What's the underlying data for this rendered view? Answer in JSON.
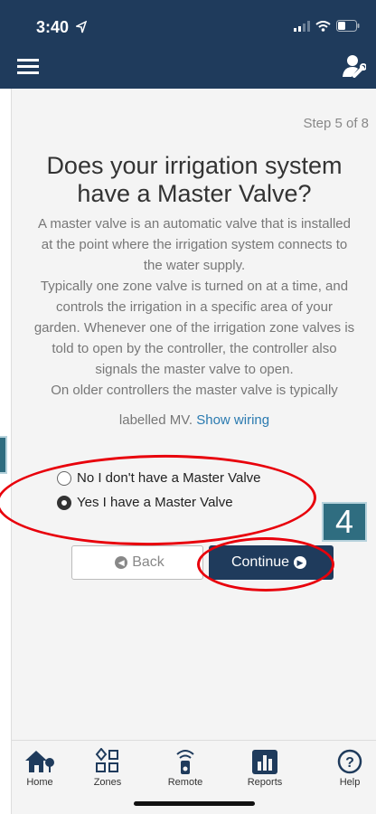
{
  "status_bar": {
    "time": "3:40"
  },
  "colors": {
    "primary": "#1f3b5c",
    "link": "#2a7ab0",
    "annotation_red": "#e8000b",
    "callout": "#2f6d80"
  },
  "icons": {
    "menu": "hamburger-menu-icon",
    "settings": "wrench-user-icon"
  },
  "page": {
    "step": "Step 5 of 8",
    "title_line1": "Does your irrigation system",
    "title_line2": "have a Master Valve?",
    "desc_lines": [
      "A master valve is an automatic valve that is installed",
      "at the point where the irrigation system connects to",
      "the water supply.",
      "Typically one zone valve is turned on at a time, and",
      "controls the irrigation in a specific area of your",
      "garden. Whenever one of the irrigation zone valves is",
      "told to open by the controller, the controller also",
      "signals the master valve to open.",
      "On older controllers the master valve is typically"
    ],
    "desc_last": "labelled MV.",
    "show_wiring": "Show wiring"
  },
  "options": [
    {
      "label": "No I don't have a Master Valve",
      "selected": false
    },
    {
      "label": "Yes I have a Master Valve",
      "selected": true
    }
  ],
  "buttons": {
    "back": "Back",
    "continue": "Continue"
  },
  "callout_number": "4",
  "tabs": [
    {
      "label": "Home",
      "icon": "home-icon"
    },
    {
      "label": "Zones",
      "icon": "zones-icon"
    },
    {
      "label": "Remote",
      "icon": "remote-icon"
    },
    {
      "label": "Reports",
      "icon": "reports-icon"
    },
    {
      "label": "Help",
      "icon": "help-icon"
    }
  ]
}
